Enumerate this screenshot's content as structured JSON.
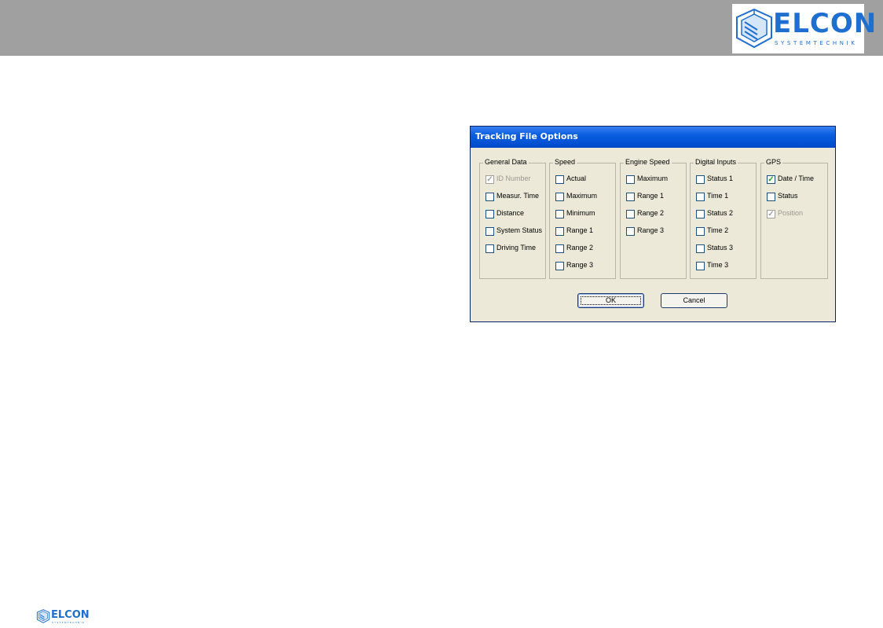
{
  "header": {
    "logo_word": "ELCON",
    "logo_sub": "SYSTEMTECHNIK"
  },
  "footer": {
    "logo_word": "ELCON",
    "logo_sub": "SYSTEMTECHNIK"
  },
  "dialog": {
    "title": "Tracking File Options",
    "groups": [
      {
        "label": "General Data",
        "options": [
          {
            "label": "ID Number",
            "checked": true,
            "disabled": true
          },
          {
            "label": "Measur. Time",
            "checked": false,
            "disabled": false
          },
          {
            "label": "Distance",
            "checked": false,
            "disabled": false
          },
          {
            "label": "System Status",
            "checked": false,
            "disabled": false
          },
          {
            "label": "Driving Time",
            "checked": false,
            "disabled": false
          }
        ]
      },
      {
        "label": "Speed",
        "options": [
          {
            "label": "Actual",
            "checked": false,
            "disabled": false
          },
          {
            "label": "Maximum",
            "checked": false,
            "disabled": false
          },
          {
            "label": "Minimum",
            "checked": false,
            "disabled": false
          },
          {
            "label": "Range 1",
            "checked": false,
            "disabled": false
          },
          {
            "label": "Range 2",
            "checked": false,
            "disabled": false
          },
          {
            "label": "Range 3",
            "checked": false,
            "disabled": false
          }
        ]
      },
      {
        "label": "Engine Speed",
        "options": [
          {
            "label": "Maximum",
            "checked": false,
            "disabled": false
          },
          {
            "label": "Range 1",
            "checked": false,
            "disabled": false
          },
          {
            "label": "Range 2",
            "checked": false,
            "disabled": false
          },
          {
            "label": "Range 3",
            "checked": false,
            "disabled": false
          }
        ]
      },
      {
        "label": "Digital Inputs",
        "options": [
          {
            "label": "Status 1",
            "checked": false,
            "disabled": false
          },
          {
            "label": "Time 1",
            "checked": false,
            "disabled": false
          },
          {
            "label": "Status 2",
            "checked": false,
            "disabled": false
          },
          {
            "label": "Time 2",
            "checked": false,
            "disabled": false
          },
          {
            "label": "Status 3",
            "checked": false,
            "disabled": false
          },
          {
            "label": "Time 3",
            "checked": false,
            "disabled": false
          }
        ]
      },
      {
        "label": "GPS",
        "options": [
          {
            "label": "Date / Time",
            "checked": true,
            "disabled": false
          },
          {
            "label": "Status",
            "checked": false,
            "disabled": false
          },
          {
            "label": "Position",
            "checked": true,
            "disabled": true
          }
        ]
      }
    ],
    "ok_label": "OK",
    "cancel_label": "Cancel"
  },
  "colors": {
    "header_bar": "#a0a0a0",
    "brand_blue": "#1f6fd1",
    "dialog_bg": "#ece9d8",
    "titlebar_blue": "#0a5ee0",
    "check_green": "#21a121"
  },
  "icons": {
    "header_logo": "elcon-cube-logo-icon",
    "footer_logo": "elcon-cube-logo-icon",
    "check_mark": "check-mark-icon"
  }
}
